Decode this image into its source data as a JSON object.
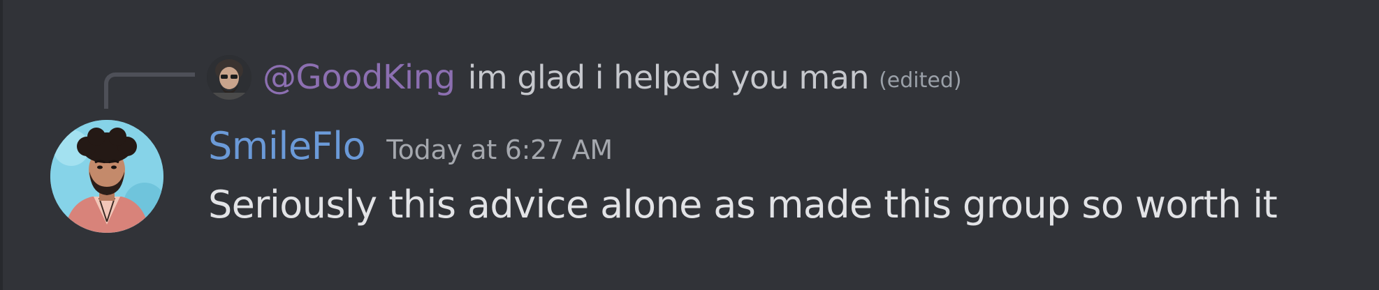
{
  "reply": {
    "author": "@GoodKing",
    "text": "im glad i helped you man",
    "edited_label": "(edited)"
  },
  "message": {
    "author": "SmileFlo",
    "timestamp": "Today at 6:27 AM",
    "content": "Seriously this advice alone as made this group so worth it"
  },
  "colors": {
    "background": "#313338",
    "reply_author": "#8c6fb1",
    "username": "#6b9ad8",
    "text": "#e2e3e6",
    "muted": "#a5a8ae"
  }
}
